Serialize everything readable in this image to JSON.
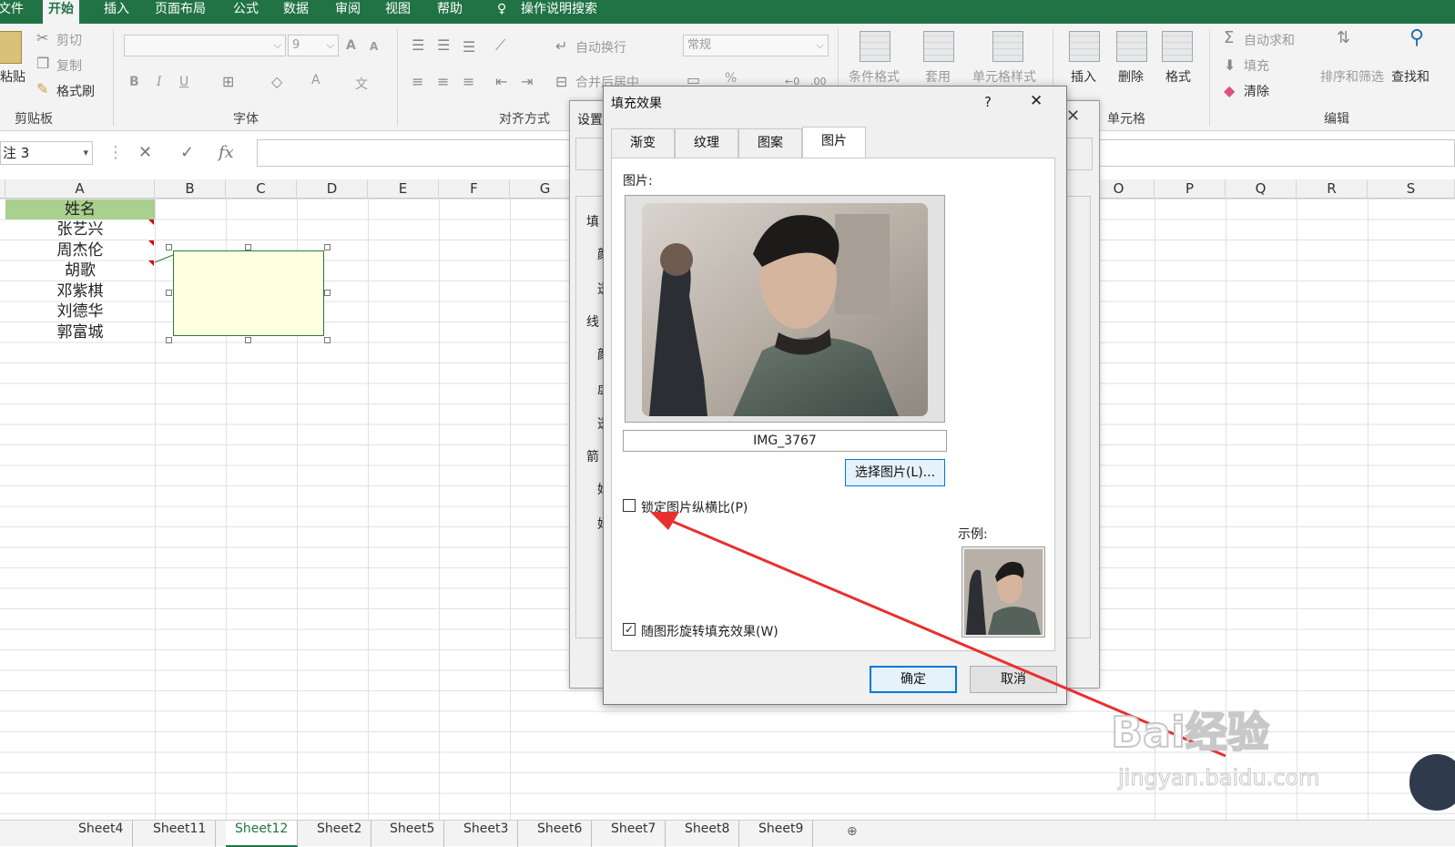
{
  "ribbon": {
    "tabs": [
      "文件",
      "开始",
      "插入",
      "页面布局",
      "公式",
      "数据",
      "审阅",
      "视图",
      "帮助"
    ],
    "active_tab": "开始",
    "search_label": "操作说明搜索",
    "clipboard": {
      "paste": "粘贴",
      "cut": "剪切",
      "copy": "复制",
      "format_painter": "格式刷",
      "group": "剪贴板"
    },
    "font": {
      "name": "",
      "size": "9",
      "bold": "B",
      "italic": "I",
      "underline": "U",
      "grow": "A",
      "shrink": "A",
      "color_a": "A",
      "phonetic": "文",
      "group": "字体"
    },
    "alignment": {
      "wrap": "自动换行",
      "merge": "合并后居中",
      "group": "对齐方式"
    },
    "number": {
      "format": "常规",
      "percent": "%"
    },
    "styles": {
      "conditional": "条件格式",
      "table": "套用",
      "cell_styles": "单元格样式"
    },
    "cells": {
      "insert": "插入",
      "delete": "删除",
      "format": "格式",
      "group": "单元格"
    },
    "editing": {
      "autosum": "自动求和",
      "fill": "填充",
      "clear": "清除",
      "sort": "排序和筛选",
      "find": "查找和",
      "group": "编辑"
    }
  },
  "formula_bar": {
    "name_box": "注 3",
    "fx": "fx",
    "cancel": "✕",
    "enter": "✓"
  },
  "columns": [
    "A",
    "B",
    "C",
    "D",
    "E",
    "F",
    "G",
    "O",
    "P",
    "Q",
    "R",
    "S"
  ],
  "cells": [
    "姓名",
    "张艺兴",
    "周杰伦",
    "胡歌",
    "邓紫棋",
    "刘德华",
    "郭富城"
  ],
  "sheets": [
    "Sheet4",
    "Sheet11",
    "Sheet12",
    "Sheet2",
    "Sheet5",
    "Sheet3",
    "Sheet6",
    "Sheet7",
    "Sheet8",
    "Sheet9"
  ],
  "active_sheet": "Sheet12",
  "bg_dialog": {
    "title": "设置",
    "labels": [
      "填",
      "颜",
      "透",
      "线",
      "颜",
      "虚",
      "透",
      "箭",
      "始",
      "始"
    ]
  },
  "dialog": {
    "title": "填充效果",
    "help": "?",
    "close": "✕",
    "tabs": [
      "渐变",
      "纹理",
      "图案",
      "图片"
    ],
    "active_tab": "图片",
    "picture_label": "图片:",
    "filename": "IMG_3767",
    "select_button": "选择图片(L)...",
    "lock_aspect": "锁定图片纵横比(P)",
    "lock_aspect_checked": false,
    "rotate_with_shape": "随图形旋转填充效果(W)",
    "rotate_with_shape_checked": true,
    "sample_label": "示例:",
    "ok": "确定",
    "cancel": "取消"
  },
  "watermark": {
    "brand": "Bai经验",
    "url": "jingyan.baidu.com"
  },
  "colors": {
    "excel_green": "#217346",
    "arrow_red": "#e8302f",
    "header_a": "#a9d08e"
  }
}
